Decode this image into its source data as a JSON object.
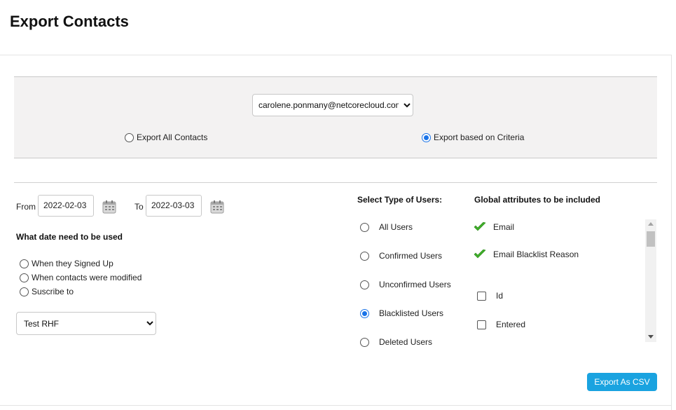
{
  "page": {
    "title": "Export Contacts"
  },
  "account": {
    "selected": "carolene.ponmany@netcorecloud.com"
  },
  "export_mode": {
    "options": [
      {
        "label": "Export All Contacts",
        "checked": false
      },
      {
        "label": "Export based on Criteria",
        "checked": true
      }
    ]
  },
  "date_range": {
    "from_label": "From",
    "from_value": "2022-02-03",
    "to_label": "To",
    "to_value": "2022-03-03"
  },
  "date_usage": {
    "heading": "What date need to be used",
    "options": [
      {
        "label": "When they Signed Up",
        "checked": false
      },
      {
        "label": "When contacts were modified",
        "checked": false
      },
      {
        "label": "Suscribe to",
        "checked": false
      }
    ]
  },
  "list": {
    "selected": "Test RHF"
  },
  "user_types": {
    "heading": "Select Type of Users:",
    "options": [
      {
        "label": "All Users",
        "checked": false
      },
      {
        "label": "Confirmed Users",
        "checked": false
      },
      {
        "label": "Unconfirmed Users",
        "checked": false
      },
      {
        "label": "Blacklisted Users",
        "checked": true
      },
      {
        "label": "Deleted Users",
        "checked": false
      }
    ]
  },
  "attributes": {
    "heading": "Global attributes to be included",
    "items": [
      {
        "label": "Email",
        "included": true,
        "fixed": true
      },
      {
        "label": "Email Blacklist Reason",
        "included": true,
        "fixed": true
      },
      {
        "label": "Id",
        "included": false,
        "fixed": false
      },
      {
        "label": "Entered",
        "included": false,
        "fixed": false
      }
    ]
  },
  "actions": {
    "export_label": "Export As CSV"
  },
  "colors": {
    "accent": "#1aa3e0",
    "radio_selected": "#1a73e8",
    "check": "#3fae29"
  },
  "icons": {
    "calendar": "calendar-icon",
    "check": "checkmark-icon"
  }
}
